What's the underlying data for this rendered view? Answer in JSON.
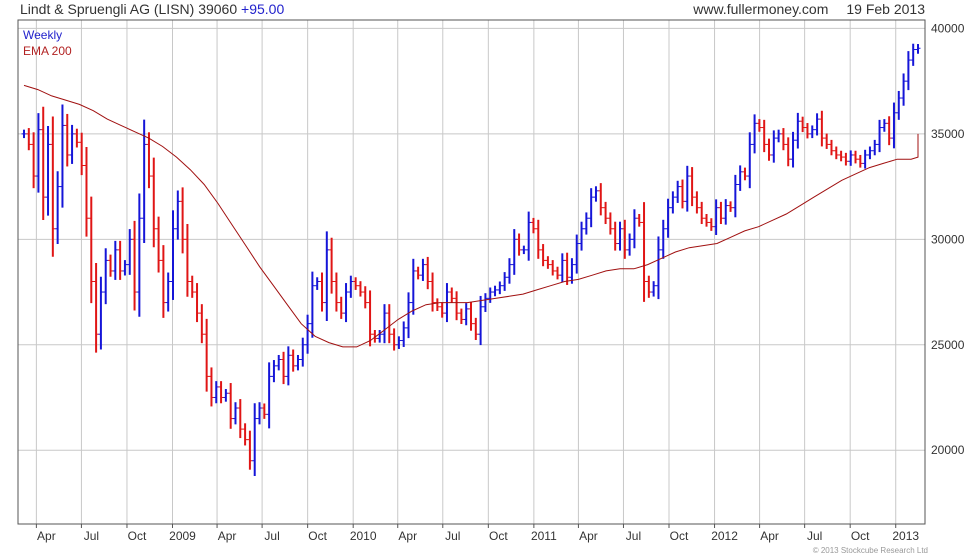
{
  "header": {
    "title": "Lindt & Spruengli AG (LISN) 39060",
    "change": "+95.00",
    "site": "www.fullermoney.com",
    "date": "19 Feb 2013"
  },
  "footer": {
    "copyright": "© 2013 Stockcube Research Ltd"
  },
  "colors": {
    "up": "#1515d8",
    "down": "#e01515",
    "ema": "#a01010",
    "grid": "#c8c8c8",
    "frame": "#555555"
  },
  "chart_data": {
    "type": "line",
    "title": "Lindt & Spruengli AG (LISN) 39060 +95.00",
    "legend": [
      "Weekly",
      "EMA 200"
    ],
    "legend_placement": "top-left",
    "grid": true,
    "ylim": [
      16500,
      40400
    ],
    "y_ticks": [
      {
        "label": "40000",
        "value": 40000
      },
      {
        "label": "35000",
        "value": 35000
      },
      {
        "label": "30000",
        "value": 30000
      },
      {
        "label": "25000",
        "value": 25000
      },
      {
        "label": "20000",
        "value": 20000
      }
    ],
    "x_ticks": [
      "Apr",
      "Jul",
      "Oct",
      "2009",
      "Apr",
      "Jul",
      "Oct",
      "2010",
      "Apr",
      "Jul",
      "Oct",
      "2011",
      "Apr",
      "Jul",
      "Oct",
      "2012",
      "Apr",
      "Jul",
      "Oct",
      "2013"
    ],
    "series": [
      {
        "name": "Weekly",
        "values": [
          35000,
          34500,
          33000,
          35200,
          32000,
          34500,
          30500,
          32500,
          35400,
          34000,
          35000,
          34600,
          33500,
          31000,
          28000,
          25500,
          27500,
          29000,
          28500,
          29500,
          28500,
          28800,
          30000,
          27500,
          31000,
          34500,
          33000,
          30500,
          29000,
          27000,
          28000,
          30500,
          31800,
          30000,
          28000,
          27500,
          26500,
          25500,
          23500,
          22500,
          23000,
          22500,
          22700,
          21500,
          22000,
          21000,
          20500,
          19500,
          21500,
          22000,
          21700,
          23500,
          24000,
          24300,
          23500,
          24500,
          24000,
          24300,
          25000,
          26000,
          27800,
          28000,
          27000,
          29500,
          28000,
          27000,
          26500,
          27500,
          28000,
          27800,
          27500,
          27000,
          25500,
          25300,
          25500,
          26500,
          25500,
          25000,
          25200,
          25800,
          27000,
          28500,
          28300,
          28800,
          28000,
          27000,
          26800,
          26500,
          27500,
          27200,
          26500,
          26200,
          26700,
          26000,
          25500,
          26800,
          27200,
          27500,
          27600,
          27800,
          28200,
          28800,
          30000,
          29500,
          29500,
          30800,
          30500,
          29500,
          29000,
          28800,
          28500,
          28300,
          29000,
          28200,
          28800,
          29800,
          30500,
          31000,
          32000,
          32300,
          31500,
          31000,
          30500,
          29800,
          30500,
          29500,
          30000,
          31000,
          30800,
          28000,
          27500,
          27800,
          29500,
          30500,
          31500,
          32000,
          32500,
          31800,
          33000,
          32000,
          31500,
          31000,
          30800,
          30600,
          31500,
          31000,
          31600,
          31500,
          32600,
          33200,
          33000,
          34500,
          35500,
          35300,
          34500,
          34000,
          34800,
          35000,
          34500,
          33800,
          34700,
          35600,
          35300,
          35000,
          35200,
          35700,
          34800,
          34500,
          34200,
          34000,
          33900,
          33700,
          34000,
          33800,
          33600,
          34000,
          34200,
          34500,
          35300,
          35500,
          34800,
          36000,
          36700,
          37500,
          38500,
          39000,
          39060
        ]
      },
      {
        "name": "EMA 200",
        "values": [
          37300,
          37100,
          36800,
          36600,
          36400,
          36100,
          35700,
          35400,
          35100,
          34800,
          34400,
          33900,
          33300,
          32600,
          31700,
          30700,
          29700,
          28700,
          27800,
          26900,
          26000,
          25400,
          25100,
          24900,
          24900,
          25200,
          25700,
          26200,
          26600,
          26900,
          27000,
          27000,
          27000,
          27100,
          27200,
          27300,
          27400,
          27600,
          27800,
          28000,
          28100,
          28300,
          28500,
          28600,
          28600,
          28800,
          29100,
          29400,
          29600,
          29700,
          29800,
          30100,
          30400,
          30600,
          30900,
          31200,
          31600,
          32000,
          32400,
          32800,
          33100,
          33400,
          33600,
          33800,
          33800,
          33900,
          34000,
          34300,
          35000
        ]
      }
    ],
    "x_start": "2008-03-07",
    "x_end": "2013-02-15",
    "ema_x_step_weeks": 4
  }
}
